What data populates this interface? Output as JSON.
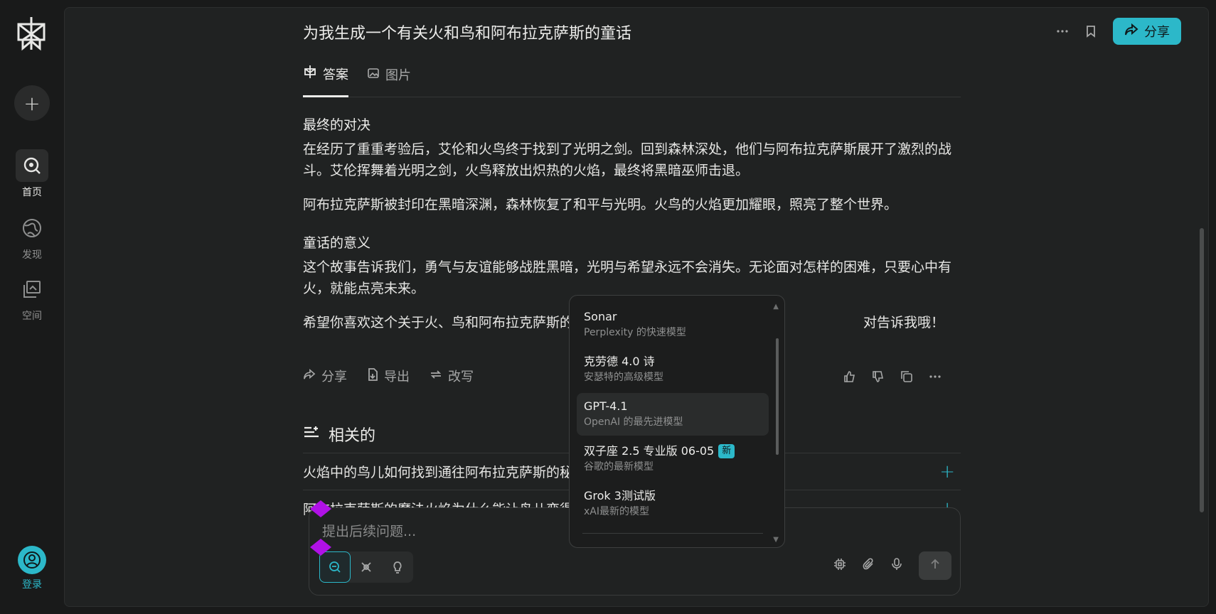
{
  "page_title": "为我生成一个有关火和鸟和阿布拉克萨斯的童话",
  "sidebar": {
    "new_label": "+",
    "items": [
      {
        "label": "首页",
        "icon": "search-icon"
      },
      {
        "label": "发现",
        "icon": "globe-icon"
      },
      {
        "label": "空间",
        "icon": "spaces-icon"
      }
    ],
    "login_label": "登录"
  },
  "header": {
    "share_label": "分享"
  },
  "tabs": [
    {
      "label": "答案",
      "icon": "perplexity-icon"
    },
    {
      "label": "图片",
      "icon": "image-icon"
    }
  ],
  "answer": {
    "section1_title": "最终的对决",
    "section1_p1": "在经历了重重考验后，艾伦和火鸟终于找到了光明之剑。回到森林深处，他们与阿布拉克萨斯展开了激烈的战斗。艾伦挥舞着光明之剑，火鸟释放出炽热的火焰，最终将黑暗巫师击退。",
    "section1_p2": "阿布拉克萨斯被封印在黑暗深渊，森林恢复了和平与光明。火鸟的火焰更加耀眼，照亮了整个世界。",
    "section2_title": "童话的意义",
    "section2_p1": "这个故事告诉我们，勇气与友谊能够战胜黑暗，光明与希望永远不会消失。无论面对怎样的困难，只要心中有火，就能点亮未来。",
    "closing": "希望你喜欢这个关于火、鸟和阿布拉克萨斯的童话故事",
    "closing_tail": "对告诉我哦！"
  },
  "answer_actions": {
    "share": "分享",
    "export": "导出",
    "rewrite": "改写"
  },
  "related": {
    "heading": "相关的",
    "items": [
      "火焰中的鸟儿如何找到通往阿布拉克萨斯的秘密路径",
      "阿布拉克萨斯的魔法火焰为什么能让鸟儿变得更强大"
    ]
  },
  "input": {
    "placeholder": "提出后续问题..."
  },
  "model_menu": {
    "items": [
      {
        "name": "Sonar",
        "desc": "Perplexity 的快速模型"
      },
      {
        "name": "克劳德 4.0 诗",
        "desc": "安瑟特的高级模型"
      },
      {
        "name": "GPT-4.1",
        "desc": "OpenAI 的最先进模型",
        "selected": true
      },
      {
        "name": "双子座 2.5 专业版 06-05",
        "desc": "谷歌的最新模型",
        "badge": "新"
      },
      {
        "name": "Grok 3测试版",
        "desc": "xAI最新的模型"
      }
    ]
  },
  "colors": {
    "accent": "#2cb8c9",
    "background": "#191a1a",
    "panel": "#202222",
    "marker": "#b011e6"
  }
}
